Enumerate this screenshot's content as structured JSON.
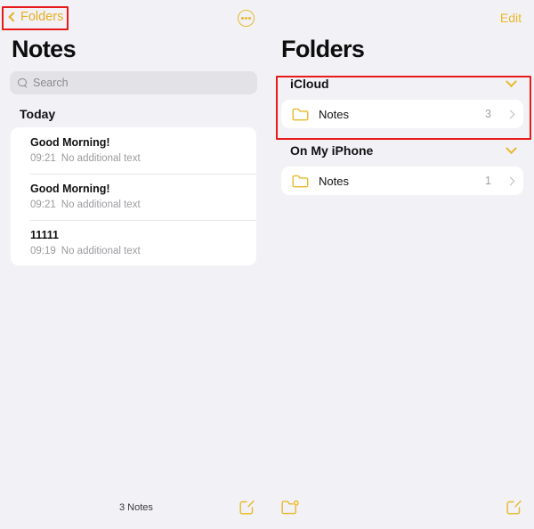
{
  "app": {
    "background_color": "#F2F1F6",
    "accent_color": "#E8B92B",
    "annotation_color": "#E81B1B"
  },
  "left_pane": {
    "back_button": {
      "label": "Folders",
      "icon": "chevron-left-icon"
    },
    "more_button": {
      "icon": "ellipsis-circle-icon"
    },
    "title": "Notes",
    "search": {
      "placeholder": "Search",
      "value": "",
      "icon": "search-icon"
    },
    "section_label": "Today",
    "notes": [
      {
        "title": "Good Morning!",
        "time": "09:21",
        "preview": "No additional text"
      },
      {
        "title": "Good Morning!",
        "time": "09:21",
        "preview": "No additional text"
      },
      {
        "title": "11111",
        "time": "09:19",
        "preview": "No additional text"
      }
    ]
  },
  "right_pane": {
    "edit_button": "Edit",
    "title": "Folders",
    "groups": [
      {
        "name": "iCloud",
        "expanded": true,
        "folders": [
          {
            "name": "Notes",
            "count": "3",
            "icon": "folder-icon"
          }
        ]
      },
      {
        "name": "On My iPhone",
        "expanded": true,
        "folders": [
          {
            "name": "Notes",
            "count": "1",
            "icon": "folder-icon"
          }
        ]
      }
    ]
  },
  "toolbar": {
    "count_label": "3 Notes",
    "compose_left_icon": "compose-icon",
    "new_folder_icon": "new-folder-icon",
    "compose_right_icon": "compose-icon"
  }
}
